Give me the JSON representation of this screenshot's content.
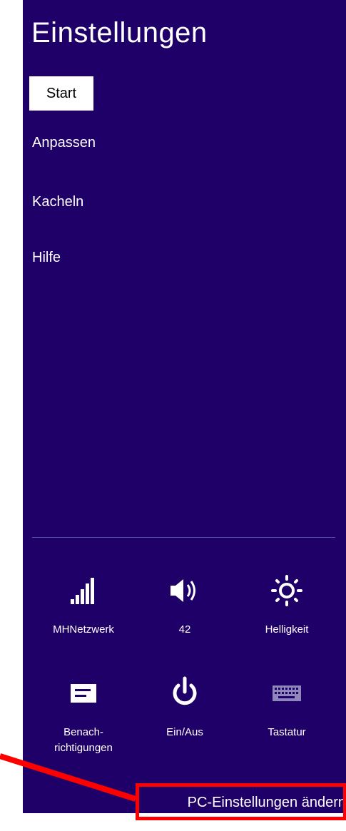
{
  "panel": {
    "title": "Einstellungen",
    "context_label": "Start",
    "menu": [
      {
        "label": "Anpassen"
      },
      {
        "label": "Kacheln"
      },
      {
        "label": "Hilfe"
      }
    ]
  },
  "quick_settings": [
    {
      "icon": "signal-bars-icon",
      "label": "MHNetzwerk"
    },
    {
      "icon": "speaker-icon",
      "label": "42"
    },
    {
      "icon": "brightness-icon",
      "label": "Helligkeit"
    },
    {
      "icon": "notifications-icon",
      "label": "Benach-\nrichtigungen"
    },
    {
      "icon": "power-icon",
      "label": "Ein/Aus"
    },
    {
      "icon": "keyboard-icon",
      "label": "Tastatur"
    }
  ],
  "footer": {
    "pc_settings_label": "PC-Einstellungen ändern"
  },
  "colors": {
    "panel_bg": "#1f0068",
    "highlight": "#ff0000",
    "disabled_icon": "#8f86bb"
  }
}
